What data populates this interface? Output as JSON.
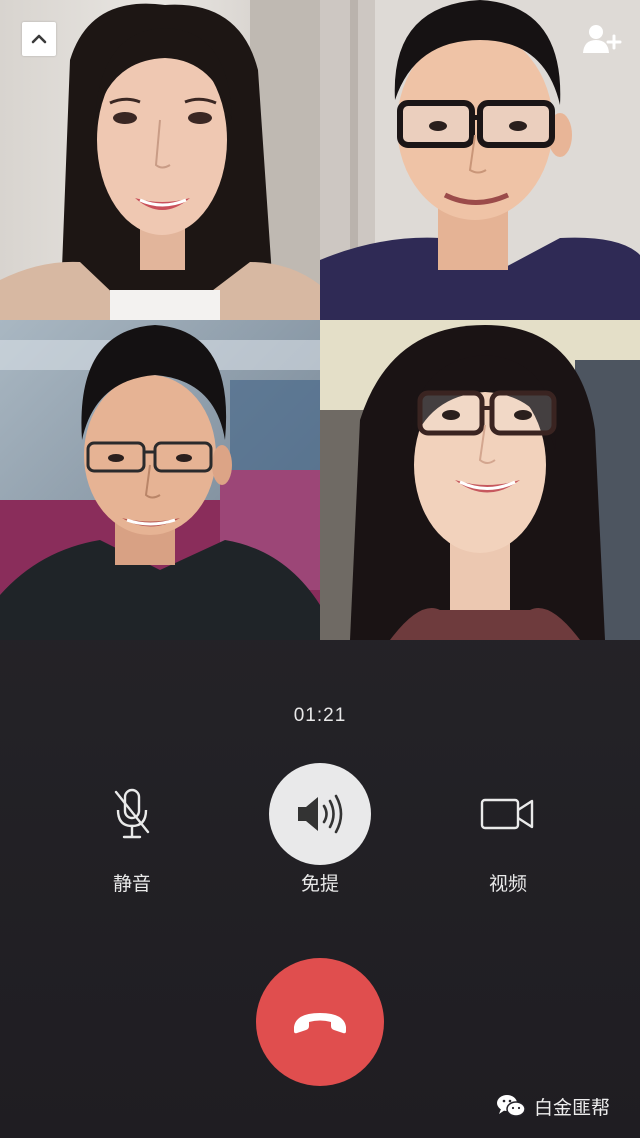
{
  "call": {
    "timer": "01:21"
  },
  "participants": [
    {
      "id": "participant-1",
      "desc": "woman-long-dark-hair"
    },
    {
      "id": "participant-2",
      "desc": "man-glasses-navy-shirt"
    },
    {
      "id": "participant-3",
      "desc": "man-glasses-black-shirt"
    },
    {
      "id": "participant-4",
      "desc": "woman-glasses-long-hair"
    }
  ],
  "controls": {
    "mute": {
      "label": "静音",
      "icon": "microphone-off-icon"
    },
    "speaker": {
      "label": "免提",
      "icon": "speaker-icon",
      "active": true
    },
    "video": {
      "label": "视频",
      "icon": "video-camera-icon"
    },
    "hangup": {
      "icon": "hang-up-phone-icon",
      "color": "#e04e4e"
    }
  },
  "top_bar": {
    "collapse_icon": "chevron-up-icon",
    "add_member_icon": "add-person-icon"
  },
  "watermark": {
    "text": "白金匪帮",
    "icon": "wechat-icon"
  },
  "colors": {
    "background": "#252428",
    "hangup": "#e04e4e",
    "speaker_active_bg": "#e9e9ea"
  }
}
